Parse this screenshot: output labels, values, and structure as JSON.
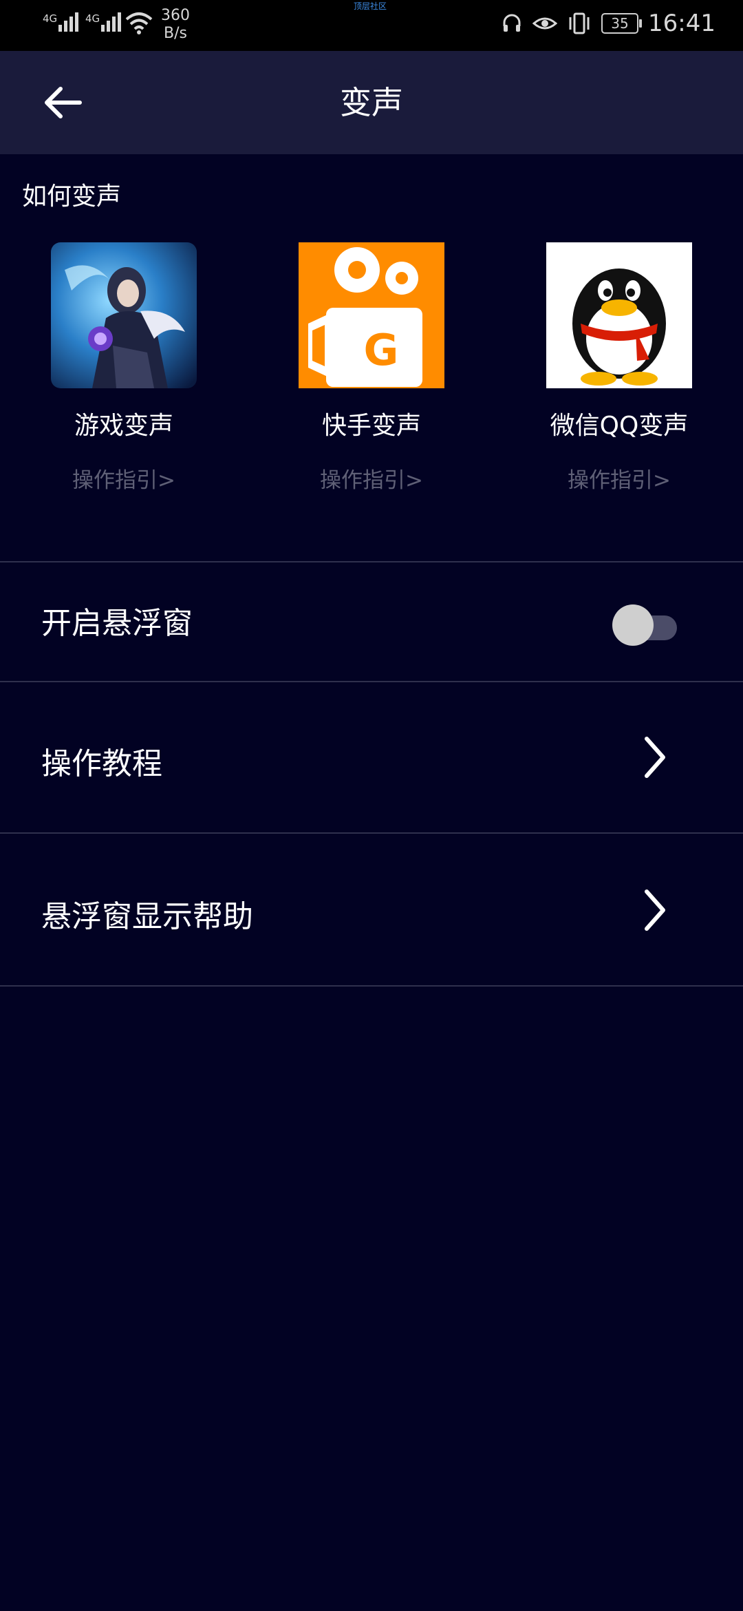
{
  "status_bar": {
    "signal1_tag": "4G",
    "signal2_tag": "4G",
    "net_speed_value": "360",
    "net_speed_unit": "B/s",
    "center_text": "顶层社区",
    "battery": "35",
    "time": "16:41",
    "icons": [
      "signal-icon",
      "signal-icon",
      "wifi-icon",
      "headset-icon",
      "eye-icon",
      "vibrate-icon",
      "battery-icon"
    ]
  },
  "header": {
    "title": "变声",
    "back_icon": "arrow-left-icon"
  },
  "section": {
    "title": "如何变声",
    "apps": [
      {
        "name": "游戏变声",
        "guide": "操作指引>"
      },
      {
        "name": "快手变声",
        "guide": "操作指引>"
      },
      {
        "name": "微信QQ变声",
        "guide": "操作指引>"
      }
    ]
  },
  "settings": {
    "float_window": {
      "label": "开启悬浮窗",
      "enabled": false
    },
    "tutorial": {
      "label": "操作教程"
    },
    "float_help": {
      "label": "悬浮窗显示帮助"
    }
  },
  "colors": {
    "background": "#020223",
    "header": "#1a1b3b",
    "guide_text": "#5f6076",
    "kuaishou_orange": "#ff8c00"
  }
}
